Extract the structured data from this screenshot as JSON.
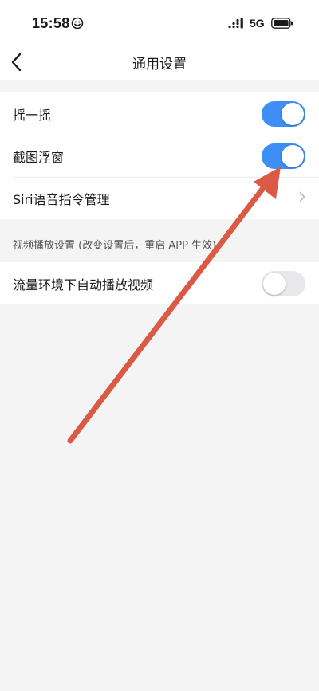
{
  "status_bar": {
    "time": "15:58",
    "network": "5G",
    "icons": [
      "smiley-icon",
      "signal-icon",
      "battery-icon"
    ]
  },
  "nav": {
    "title": "通用设置",
    "back_icon": "back-icon"
  },
  "settings": {
    "shake": {
      "label": "摇一摇",
      "state": "on"
    },
    "screenshot_float": {
      "label": "截图浮窗",
      "state": "on"
    },
    "siri": {
      "label": "Siri语音指令管理",
      "icon": "chevron-right-icon"
    }
  },
  "video": {
    "section_header": "视频播放设置 (改变设置后，重启 APP 生效)",
    "autoplay": {
      "label": "流量环境下自动播放视频",
      "state": "off"
    }
  },
  "colors": {
    "toggle_on": "#3e8ef7",
    "toggle_off": "#e9e9eb",
    "annotation_arrow": "#db5a45",
    "background": "#f4f4f4"
  }
}
